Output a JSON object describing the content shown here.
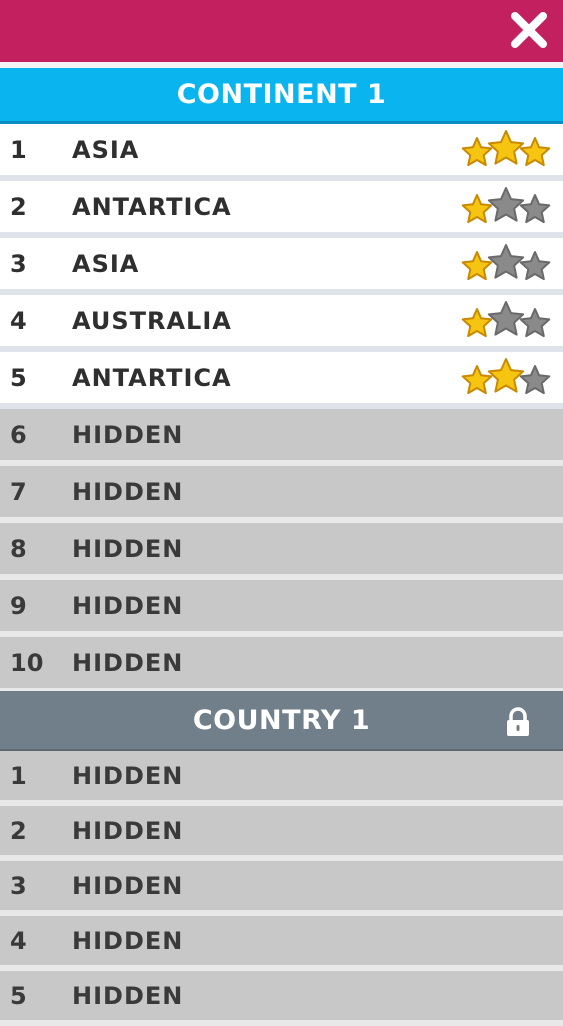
{
  "header": {
    "close_icon": "close-icon"
  },
  "colors": {
    "topbar": "#c2205f",
    "continent_header": "#0ab4ee",
    "country_header": "#717f8a",
    "star_gold": "#f6c511",
    "star_gray": "#8a8a8a"
  },
  "sections": [
    {
      "title": "CONTINENT 1",
      "locked": false,
      "items": [
        {
          "num": "1",
          "label": "ASIA",
          "stars": 3,
          "unlocked": true
        },
        {
          "num": "2",
          "label": "ANTARTICA",
          "stars": 1,
          "unlocked": true
        },
        {
          "num": "3",
          "label": "ASIA",
          "stars": 1,
          "unlocked": true
        },
        {
          "num": "4",
          "label": "AUSTRALIA",
          "stars": 1,
          "unlocked": true
        },
        {
          "num": "5",
          "label": "ANTARTICA",
          "stars": 2,
          "unlocked": true
        },
        {
          "num": "6",
          "label": "HIDDEN",
          "unlocked": false
        },
        {
          "num": "7",
          "label": "HIDDEN",
          "unlocked": false
        },
        {
          "num": "8",
          "label": "HIDDEN",
          "unlocked": false
        },
        {
          "num": "9",
          "label": "HIDDEN",
          "unlocked": false
        },
        {
          "num": "10",
          "label": "HIDDEN",
          "unlocked": false
        }
      ]
    },
    {
      "title": "COUNTRY 1",
      "locked": true,
      "lock_icon": "lock-icon",
      "items": [
        {
          "num": "1",
          "label": "HIDDEN",
          "unlocked": false
        },
        {
          "num": "2",
          "label": "HIDDEN",
          "unlocked": false
        },
        {
          "num": "3",
          "label": "HIDDEN",
          "unlocked": false
        },
        {
          "num": "4",
          "label": "HIDDEN",
          "unlocked": false
        },
        {
          "num": "5",
          "label": "HIDDEN",
          "unlocked": false
        }
      ]
    }
  ]
}
